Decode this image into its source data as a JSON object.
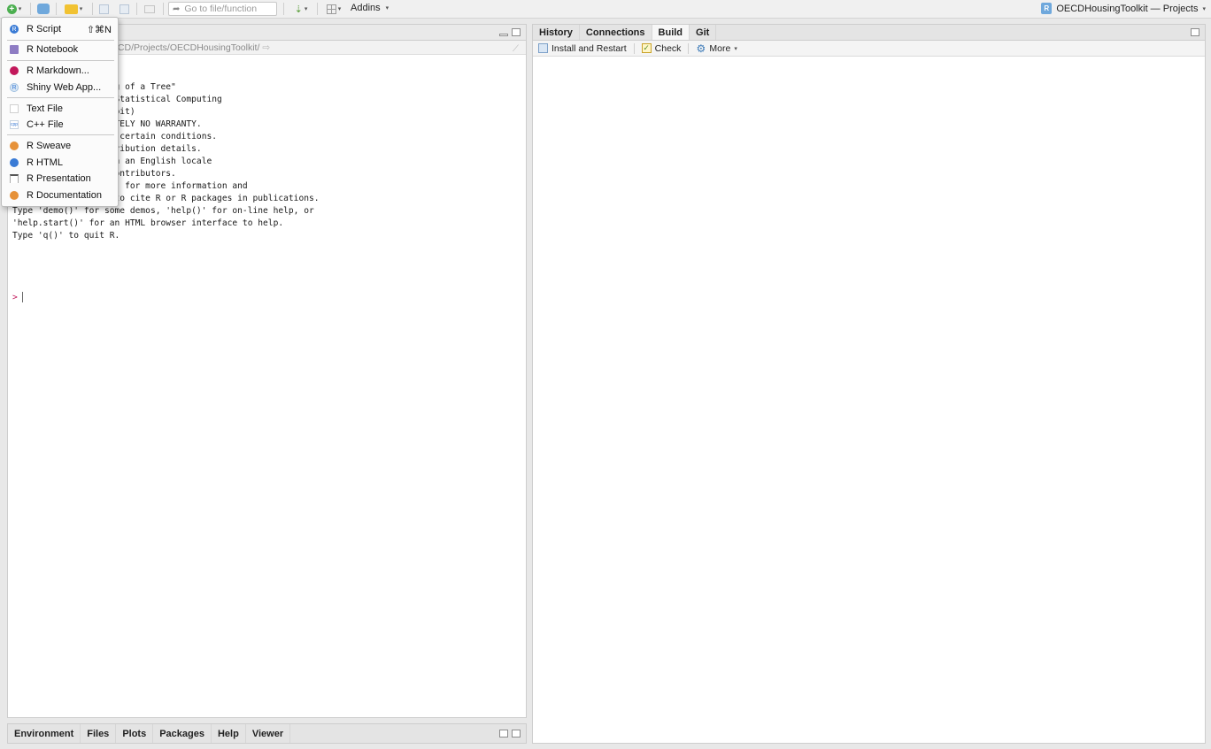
{
  "toolbar": {
    "goto_placeholder": "Go to file/function",
    "addins_label": "Addins",
    "project_label": "OECDHousingToolkit — Projects"
  },
  "new_file_menu": {
    "items": [
      {
        "label": "R Script",
        "shortcut": "⇧⌘N"
      },
      {
        "label": "R Notebook"
      },
      {
        "label": "R Markdown..."
      },
      {
        "label": "Shiny Web App..."
      },
      {
        "label": "Text File"
      },
      {
        "label": "C++ File"
      },
      {
        "label": "R Sweave"
      },
      {
        "label": "R HTML"
      },
      {
        "label": "R Presentation"
      },
      {
        "label": "R Documentation"
      }
    ]
  },
  "console": {
    "path": "essionnel/2017–2020 OECD/Projects/OECDHousingToolkit/",
    "lines": [
      "9-04-26) -- \"Planting of a Tree\"",
      "he R Foundation for Statistical Computing",
      "le-darwin15.6.0 (64-bit)",
      "",
      "nd comes with ABSOLUTELY NO WARRANTY.",
      "edistribute it under certain conditions.",
      "'licence()' for distribution details.",
      "",
      "upport but running in an English locale",
      "",
      " project with many contributors.",
      "Type 'contributors()' for more information and",
      "'citation()' on how to cite R or R packages in publications.",
      "",
      "Type 'demo()' for some demos, 'help()' for on-line help, or",
      "'help.start()' for an HTML browser interface to help.",
      "Type 'q()' to quit R."
    ],
    "prompt": ">"
  },
  "bottom_left_tabs": [
    "Environment",
    "Files",
    "Plots",
    "Packages",
    "Help",
    "Viewer"
  ],
  "right_tabs": [
    "History",
    "Connections",
    "Build",
    "Git"
  ],
  "build_toolbar": {
    "install_restart": "Install and Restart",
    "check": "Check",
    "more": "More"
  },
  "colors": {
    "rmarkdown_icon": "#c2185b",
    "r_icon_blue": "#3a7bd5",
    "sweave_icon": "#e69138",
    "prompt": "#c2185b"
  }
}
